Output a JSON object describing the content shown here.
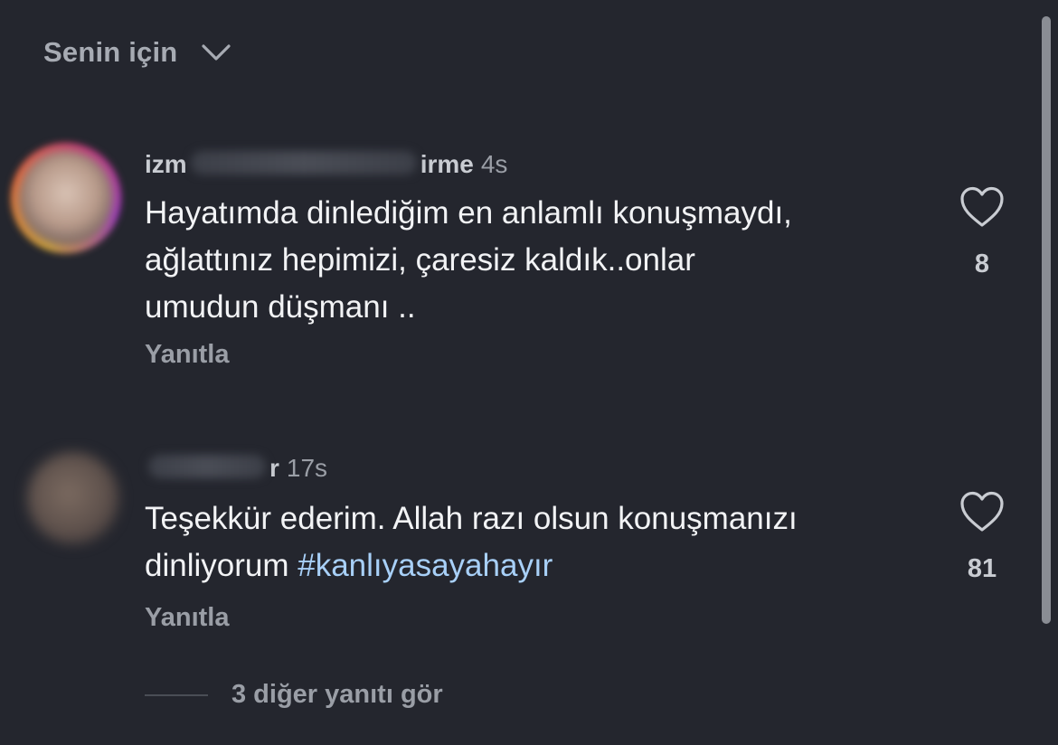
{
  "header": {
    "sort_label": "Senin için",
    "sort_icon": "chevron-down-icon"
  },
  "comments": [
    {
      "username_start": "izm",
      "username_end": "irme",
      "timestamp": "4s",
      "text": "Hayatımda dinlediğim en anlamlı konuşmaydı,\nağlattınız hepimizi, çaresiz kaldık..onlar\numudun düşmanı ..",
      "reply_label": "Yanıtla",
      "like_count": "8"
    },
    {
      "username_start": "",
      "username_end": "r",
      "timestamp": "17s",
      "text": "Teşekkür ederim. Allah razı olsun konuşmanızı\ndinliyorum ",
      "hashtag": "#kanlıyasayahayır",
      "reply_label": "Yanıtla",
      "like_count": "81"
    }
  ],
  "view_replies": {
    "label": "3 diğer yanıtı gör"
  },
  "colors": {
    "background": "#24262e",
    "text_primary": "#f2f3f5",
    "text_secondary": "#9a9ea6",
    "hashtag": "#a8d0f8"
  }
}
